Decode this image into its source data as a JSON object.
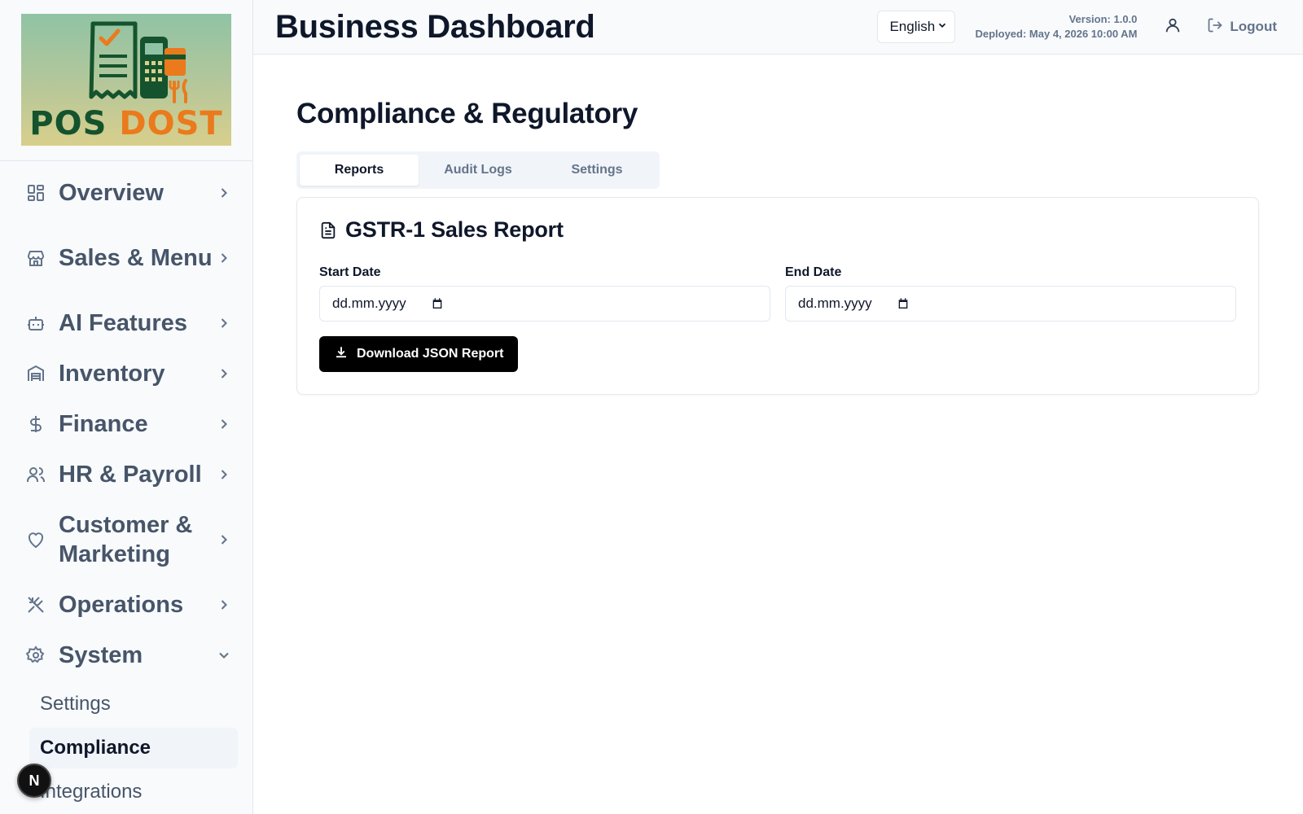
{
  "brand": {
    "logo_word_1": "POS",
    "logo_word_2": "DOST",
    "colors": {
      "primary": "#14532d",
      "accent": "#ea7a1c"
    }
  },
  "sidebar": {
    "items": [
      {
        "label": "Overview",
        "icon": "layout-dashboard-icon"
      },
      {
        "label": "Sales & Menu",
        "icon": "store-icon"
      },
      {
        "label": "AI Features",
        "icon": "bot-icon"
      },
      {
        "label": "Inventory",
        "icon": "warehouse-icon"
      },
      {
        "label": "Finance",
        "icon": "dollar-sign-icon"
      },
      {
        "label": "HR & Payroll",
        "icon": "users-icon"
      },
      {
        "label": "Customer & Marketing",
        "icon": "heart-icon"
      },
      {
        "label": "Operations",
        "icon": "utensils-crossed-icon"
      },
      {
        "label": "System",
        "icon": "settings-icon",
        "expanded": true
      }
    ],
    "system_subitems": [
      {
        "label": "Settings"
      },
      {
        "label": "Compliance",
        "active": true
      },
      {
        "label": "Integrations"
      }
    ],
    "badge": "N"
  },
  "header": {
    "title": "Business Dashboard",
    "language": "English",
    "version": "Version: 1.0.0",
    "deployed": "Deployed: May 4, 2026 10:00 AM",
    "logout": "Logout"
  },
  "main": {
    "title": "Compliance & Regulatory",
    "tabs": [
      {
        "label": "Reports",
        "active": true
      },
      {
        "label": "Audit Logs"
      },
      {
        "label": "Settings"
      }
    ],
    "card": {
      "title": "GSTR-1 Sales Report",
      "start_label": "Start Date",
      "start_value": "dd.mm.yyyy",
      "end_label": "End Date",
      "end_value": "dd.mm.yyyy",
      "download_label": "Download JSON Report"
    }
  }
}
